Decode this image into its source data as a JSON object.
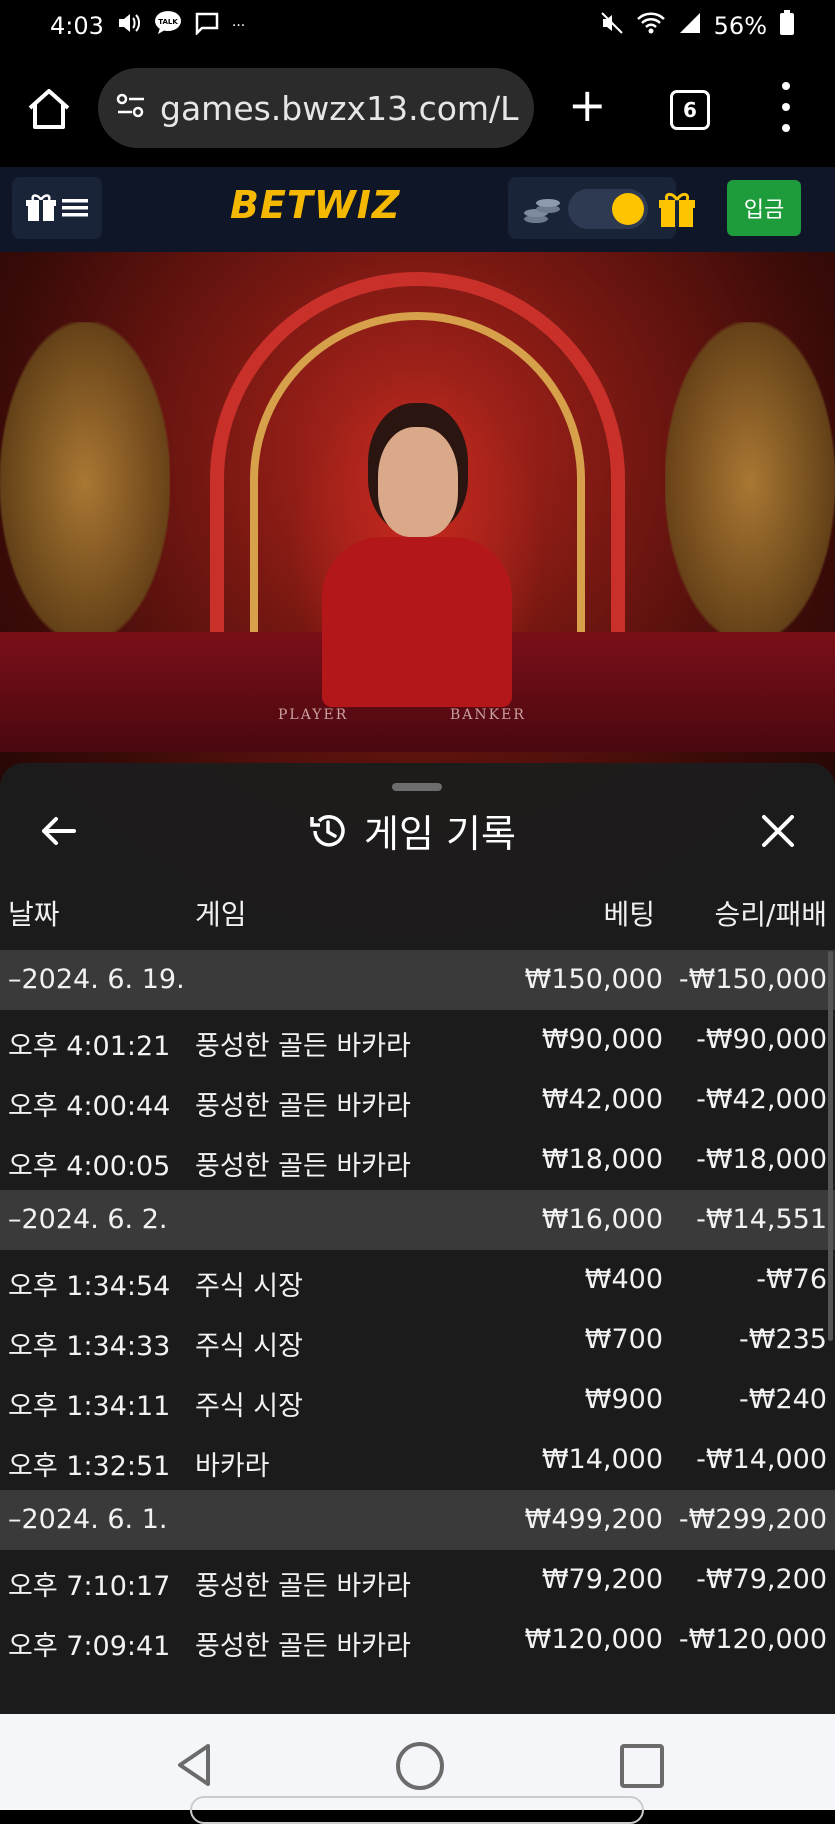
{
  "status_bar": {
    "time": "4:03",
    "notification_glyphs": "···",
    "battery": "56%"
  },
  "browser": {
    "url": "games.bwzx13.com/L",
    "tab_count": "6",
    "plus": "+"
  },
  "site_header": {
    "logo_bet": "BET",
    "logo_wiz": "WIZ",
    "deposit_label": "입금",
    "toggle_on": true
  },
  "game_table": {
    "player_label": "PLAYER",
    "banker_label": "BANKER"
  },
  "history_panel": {
    "title": "게임 기록",
    "columns": {
      "date": "날짜",
      "game": "게임",
      "bet": "베팅",
      "result": "승리/패배"
    },
    "rows": [
      {
        "type": "group",
        "date": "–2024. 6. 19.",
        "game": "",
        "bet": "₩150,000",
        "result": "-₩150,000"
      },
      {
        "type": "item",
        "date": "오후 4:01:21",
        "game": "풍성한 골든 바카라",
        "bet": "₩90,000",
        "result": "-₩90,000"
      },
      {
        "type": "item",
        "date": "오후 4:00:44",
        "game": "풍성한 골든 바카라",
        "bet": "₩42,000",
        "result": "-₩42,000"
      },
      {
        "type": "item",
        "date": "오후 4:00:05",
        "game": "풍성한 골든 바카라",
        "bet": "₩18,000",
        "result": "-₩18,000"
      },
      {
        "type": "group",
        "date": "–2024. 6. 2.",
        "game": "",
        "bet": "₩16,000",
        "result": "-₩14,551"
      },
      {
        "type": "item",
        "date": "오후 1:34:54",
        "game": "주식 시장",
        "bet": "₩400",
        "result": "-₩76"
      },
      {
        "type": "item",
        "date": "오후 1:34:33",
        "game": "주식 시장",
        "bet": "₩700",
        "result": "-₩235"
      },
      {
        "type": "item",
        "date": "오후 1:34:11",
        "game": "주식 시장",
        "bet": "₩900",
        "result": "-₩240"
      },
      {
        "type": "item",
        "date": "오후 1:32:51",
        "game": "바카라",
        "bet": "₩14,000",
        "result": "-₩14,000"
      },
      {
        "type": "group",
        "date": "–2024. 6. 1.",
        "game": "",
        "bet": "₩499,200",
        "result": "-₩299,200"
      },
      {
        "type": "item",
        "date": "오후 7:10:17",
        "game": "풍성한 골든 바카라",
        "bet": "₩79,200",
        "result": "-₩79,200"
      },
      {
        "type": "item",
        "date": "오후 7:09:41",
        "game": "풍성한 골든 바카라",
        "bet": "₩120,000",
        "result": "-₩120,000"
      }
    ]
  },
  "colors": {
    "header_bg": "#0e1628",
    "logo": "#f5b800",
    "deposit": "#1e9b3a",
    "panel_bg": "#1c1c1c",
    "group_row_bg": "#3a3a3a"
  },
  "icons": {
    "status_left": [
      "volume-icon",
      "talk-icon",
      "message-icon"
    ],
    "status_right": [
      "mute-icon",
      "wifi-icon",
      "signal-icon",
      "battery-icon"
    ],
    "browser": [
      "home-icon",
      "site-settings-icon",
      "plus-icon",
      "tabs-icon",
      "more-icon"
    ],
    "header": [
      "gift-menu-icon",
      "coins-icon",
      "gift-icon"
    ],
    "panel": [
      "back-arrow-icon",
      "history-icon",
      "close-icon"
    ],
    "nav": [
      "nav-back-icon",
      "nav-home-icon",
      "nav-recent-icon"
    ]
  }
}
